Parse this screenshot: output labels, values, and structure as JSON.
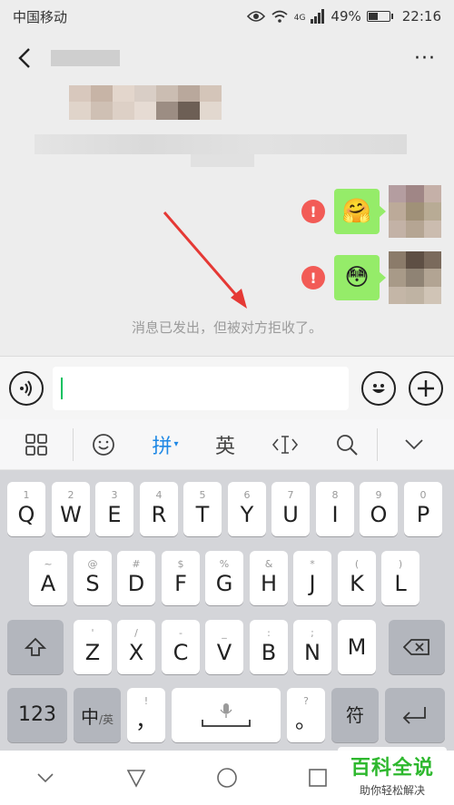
{
  "status_bar": {
    "carrier": "中国移动",
    "signal_label": "4G",
    "battery_percent": "49%",
    "battery_level": 0.49,
    "time": "22:16"
  },
  "header": {
    "back_icon": "chevron-left-icon",
    "more_label": "···"
  },
  "chat": {
    "messages": [
      {
        "status": "failed",
        "sticker": "🤗"
      },
      {
        "status": "failed",
        "sticker": "😳"
      }
    ],
    "error_mark": "!",
    "notice": "消息已发出，但被对方拒收了。"
  },
  "keyboard_toolbar": {
    "pinyin_label": "拼",
    "english_label": "英"
  },
  "keyboard": {
    "row1": [
      {
        "hint": "1",
        "main": "Q"
      },
      {
        "hint": "2",
        "main": "W"
      },
      {
        "hint": "3",
        "main": "E"
      },
      {
        "hint": "4",
        "main": "R"
      },
      {
        "hint": "5",
        "main": "T"
      },
      {
        "hint": "6",
        "main": "Y"
      },
      {
        "hint": "7",
        "main": "U"
      },
      {
        "hint": "8",
        "main": "I"
      },
      {
        "hint": "9",
        "main": "O"
      },
      {
        "hint": "0",
        "main": "P"
      }
    ],
    "row2": [
      {
        "hint": "~",
        "main": "A"
      },
      {
        "hint": "@",
        "main": "S"
      },
      {
        "hint": "#",
        "main": "D"
      },
      {
        "hint": "$",
        "main": "F"
      },
      {
        "hint": "%",
        "main": "G"
      },
      {
        "hint": "&",
        "main": "H"
      },
      {
        "hint": "*",
        "main": "J"
      },
      {
        "hint": "(",
        "main": "K"
      },
      {
        "hint": ")",
        "main": "L"
      }
    ],
    "row3": [
      {
        "hint": "'",
        "main": "Z"
      },
      {
        "hint": "/",
        "main": "X"
      },
      {
        "hint": "-",
        "main": "C"
      },
      {
        "hint": "_",
        "main": "V"
      },
      {
        "hint": ":",
        "main": "B"
      },
      {
        "hint": ";",
        "main": "N"
      },
      {
        "hint": "",
        "main": "M"
      }
    ],
    "num_key": "123",
    "lang_key_main": "中",
    "lang_key_sub": "/英",
    "comma_hint": "!",
    "comma_main": "，",
    "period_hint": "?",
    "period_main": "。",
    "symbol_key": "符"
  },
  "watermark": {
    "title": "百科全说",
    "subtitle": "助你轻松解决"
  },
  "colors": {
    "bubble": "#95ec69",
    "error": "#f25b56",
    "caret": "#07c160",
    "arrow": "#e53935",
    "pinyin": "#1e88e5"
  }
}
